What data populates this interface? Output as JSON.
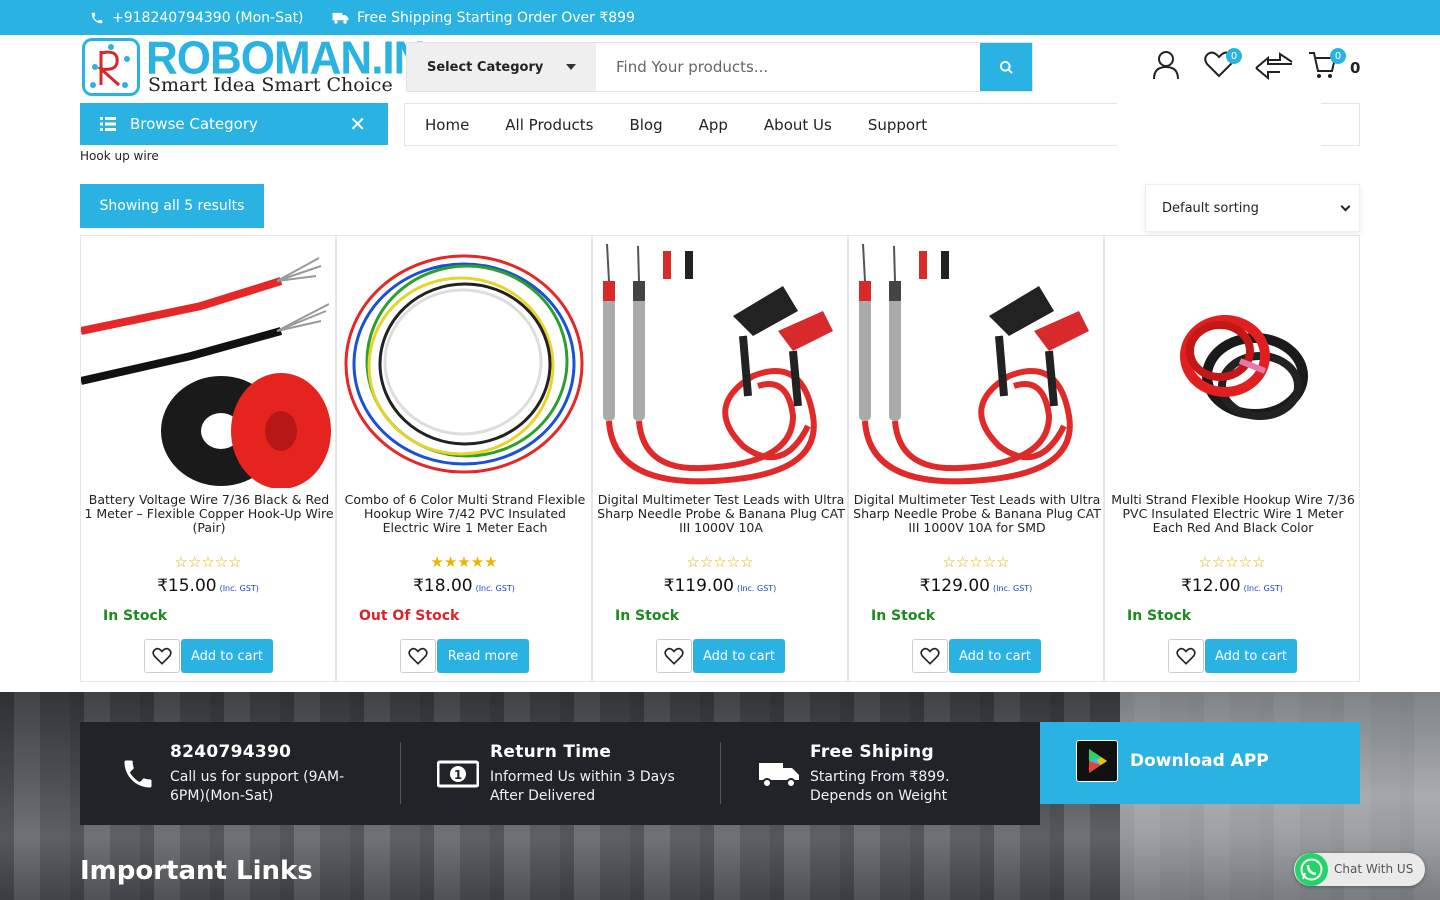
{
  "topbar": {
    "phone": "+918240794390 (Mon-Sat)",
    "shipping": "Free Shipping Starting Order Over ₹899"
  },
  "header": {
    "brand": "ROBOMAN.IN",
    "tagline": "Smart Idea Smart Choice",
    "search": {
      "category": "Select Category",
      "placeholder": "Find Your products..."
    },
    "wishlist_count": "0",
    "cart_badge": "0",
    "cart_total": "0"
  },
  "nav": {
    "browse_label": "Browse Category",
    "items": [
      "Home",
      "All Products",
      "Blog",
      "App",
      "About Us",
      "Support"
    ]
  },
  "breadcrumb": "Hook up wire",
  "results_label": "Showing all 5 results",
  "sorting": "Default sorting",
  "products": [
    {
      "title": "Battery Voltage Wire 7/36 Black & Red 1 Meter – Flexible Copper Hook-Up Wire (Pair)",
      "price": "₹15.00",
      "gst": "(Inc. GST)",
      "rating": 0,
      "stock": "In Stock",
      "action": "Add to cart"
    },
    {
      "title": "Combo of 6 Color Multi Strand Flexible Hookup Wire 7/42 PVC Insulated Electric Wire 1 Meter Each",
      "price": "₹18.00",
      "gst": "(Inc. GST)",
      "rating": 5,
      "stock": "Out Of Stock",
      "action": "Read more"
    },
    {
      "title": "Digital Multimeter Test Leads with Ultra Sharp Needle Probe & Banana Plug CAT III 1000V 10A",
      "price": "₹119.00",
      "gst": "(Inc. GST)",
      "rating": 0,
      "stock": "In Stock",
      "action": "Add to cart"
    },
    {
      "title": "Digital Multimeter Test Leads with Ultra Sharp Needle Probe & Banana Plug CAT III 1000V 10A for SMD",
      "price": "₹129.00",
      "gst": "(Inc. GST)",
      "rating": 0,
      "stock": "In Stock",
      "action": "Add to cart"
    },
    {
      "title": "Multi Strand Flexible Hookup Wire 7/36 PVC Insulated Electric Wire 1 Meter Each Red And Black Color",
      "price": "₹12.00",
      "gst": "(Inc. GST)",
      "rating": 0,
      "stock": "In Stock",
      "action": "Add to cart"
    }
  ],
  "footer": {
    "features": [
      {
        "title": "8240794390",
        "desc": "Call us for support (9AM-6PM)(Mon-Sat)",
        "icon": "phone-icon"
      },
      {
        "title": "Return Time",
        "desc": "Informed Us within 3 Days After Delivered",
        "icon": "money-icon"
      },
      {
        "title": "Free Shiping",
        "desc": "Starting From ₹899. Depends on Weight",
        "icon": "truck-icon"
      }
    ],
    "download_label": "Download APP",
    "important_links": "Important Links"
  },
  "chat_label": "Chat With US",
  "colors": {
    "accent": "#2ab3e2",
    "in_stock": "#1e8a1e",
    "out_of_stock": "#d8262b",
    "star": "#e8b500"
  }
}
